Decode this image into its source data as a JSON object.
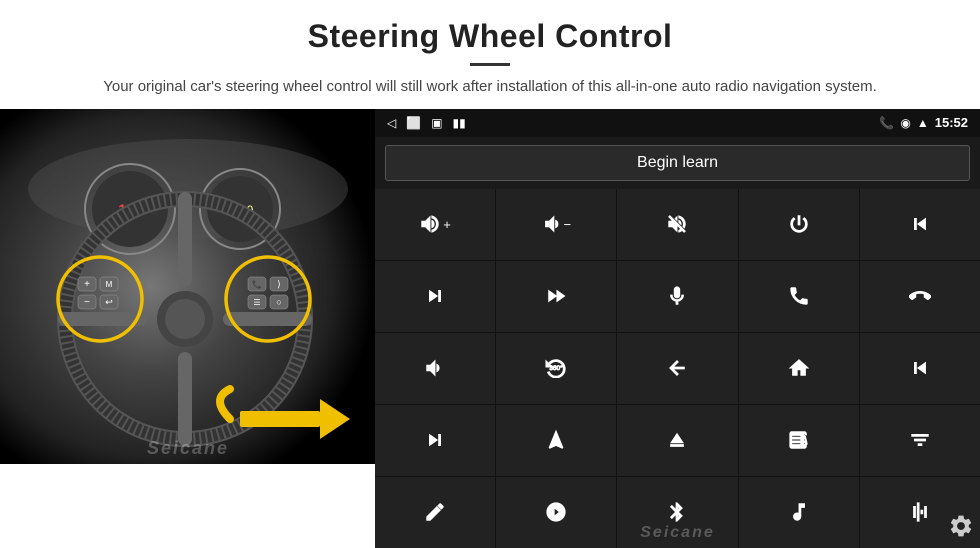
{
  "header": {
    "title": "Steering Wheel Control",
    "subtitle": "Your original car's steering wheel control will still work after installation of this all-in-one auto radio navigation system."
  },
  "android_screen": {
    "status_bar": {
      "time": "15:52",
      "icons": [
        "back-arrow",
        "home-circle",
        "square",
        "signal",
        "battery"
      ]
    },
    "begin_learn_label": "Begin learn",
    "controls": [
      {
        "icon": "vol-up",
        "symbol": "🔊+"
      },
      {
        "icon": "vol-down",
        "symbol": "🔉−"
      },
      {
        "icon": "mute",
        "symbol": "🔇"
      },
      {
        "icon": "power",
        "symbol": "⏻"
      },
      {
        "icon": "prev-track",
        "symbol": "⏮"
      },
      {
        "icon": "next-track",
        "symbol": "⏭"
      },
      {
        "icon": "fast-forward-mute",
        "symbol": "⏩"
      },
      {
        "icon": "mic",
        "symbol": "🎤"
      },
      {
        "icon": "phone",
        "symbol": "📞"
      },
      {
        "icon": "hang-up",
        "symbol": "📵"
      },
      {
        "icon": "horn",
        "symbol": "📢"
      },
      {
        "icon": "360",
        "symbol": "360"
      },
      {
        "icon": "back",
        "symbol": "↩"
      },
      {
        "icon": "home",
        "symbol": "🏠"
      },
      {
        "icon": "skip-back",
        "symbol": "⏮⏮"
      },
      {
        "icon": "skip-forward",
        "symbol": "⏭"
      },
      {
        "icon": "nav",
        "symbol": "▶"
      },
      {
        "icon": "eject",
        "symbol": "⏏"
      },
      {
        "icon": "radio",
        "symbol": "📻"
      },
      {
        "icon": "eq",
        "symbol": "🎚"
      },
      {
        "icon": "pen",
        "symbol": "✏"
      },
      {
        "icon": "settings-circle",
        "symbol": "⚙"
      },
      {
        "icon": "bluetooth",
        "symbol": "🔵"
      },
      {
        "icon": "music",
        "symbol": "🎵"
      },
      {
        "icon": "waveform",
        "symbol": "📶"
      }
    ]
  }
}
